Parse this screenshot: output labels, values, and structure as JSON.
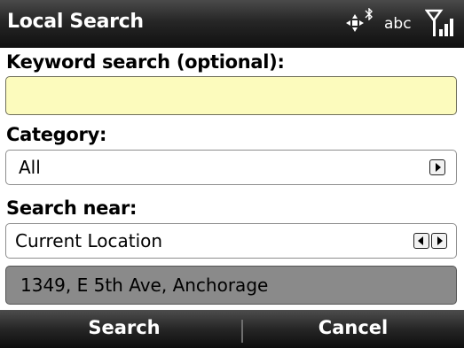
{
  "window": {
    "title": "Local Search"
  },
  "status": {
    "icons": [
      "navigation-pad-icon",
      "bluetooth-icon",
      "signal-strength-icon"
    ],
    "input_mode": "abc"
  },
  "form": {
    "keyword": {
      "label": "Keyword search (optional):",
      "value": ""
    },
    "category": {
      "label": "Category:",
      "value": "All"
    },
    "near": {
      "label": "Search near:",
      "value": "Current Location",
      "address": "1349, E 5th Ave, Anchorage"
    }
  },
  "softkeys": {
    "left": "Search",
    "right": "Cancel"
  },
  "colors": {
    "titlebar": "#262626",
    "keyword_field": "#fcfbbd",
    "address_highlight": "#8a8a8a"
  }
}
